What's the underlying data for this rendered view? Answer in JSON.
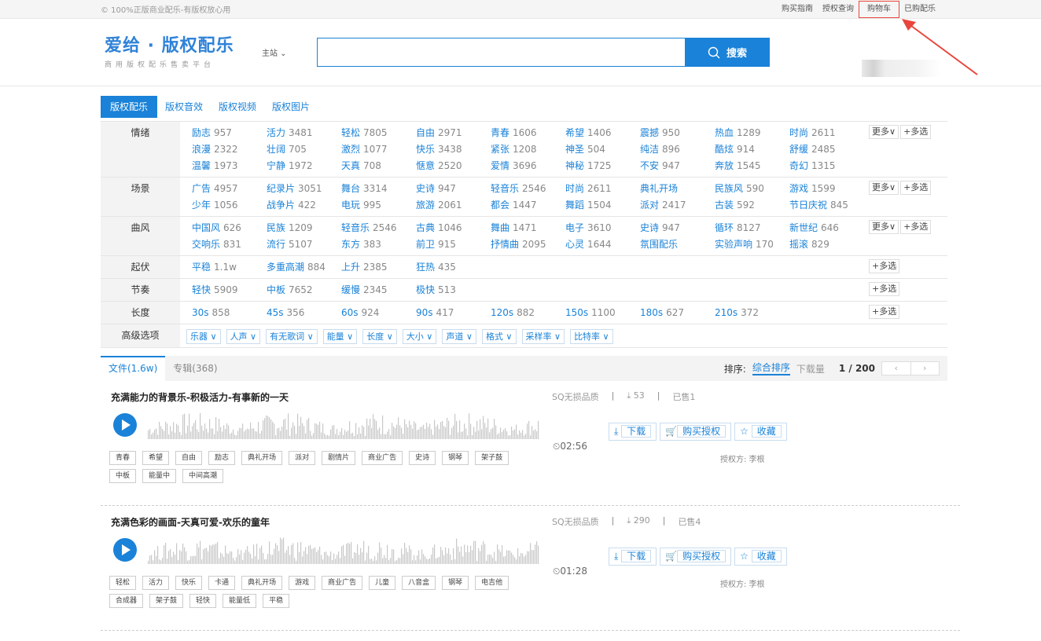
{
  "topbar": {
    "slogan": "© 100%正版商业配乐-有版权放心用",
    "links": [
      "购买指南",
      "授权查询",
      "购物车",
      "已购配乐"
    ]
  },
  "logo": {
    "title": "爱给 · 版权配乐",
    "subtitle": "商用版权配乐售卖平台"
  },
  "site_selector": "主站 ⌄",
  "search": {
    "value": "",
    "button": "搜索"
  },
  "main_tabs": [
    "版权配乐",
    "版权音效",
    "版权视频",
    "版权图片"
  ],
  "filters": {
    "mood": {
      "label": "情绪",
      "items": [
        [
          "励志",
          "957"
        ],
        [
          "活力",
          "3481"
        ],
        [
          "轻松",
          "7805"
        ],
        [
          "自由",
          "2971"
        ],
        [
          "青春",
          "1606"
        ],
        [
          "希望",
          "1406"
        ],
        [
          "震撼",
          "950"
        ],
        [
          "热血",
          "1289"
        ],
        [
          "时尚",
          "2611"
        ],
        [
          "浪漫",
          "2322"
        ],
        [
          "壮阔",
          "705"
        ],
        [
          "激烈",
          "1077"
        ],
        [
          "快乐",
          "3438"
        ],
        [
          "紧张",
          "1208"
        ],
        [
          "神圣",
          "504"
        ],
        [
          "纯洁",
          "896"
        ],
        [
          "酷炫",
          "914"
        ],
        [
          "舒缓",
          "2485"
        ],
        [
          "温馨",
          "1973"
        ],
        [
          "宁静",
          "1972"
        ],
        [
          "天真",
          "708"
        ],
        [
          "惬意",
          "2520"
        ],
        [
          "爱情",
          "3696"
        ],
        [
          "神秘",
          "1725"
        ],
        [
          "不安",
          "947"
        ],
        [
          "奔放",
          "1545"
        ],
        [
          "奇幻",
          "1315"
        ]
      ]
    },
    "scene": {
      "label": "场景",
      "items": [
        [
          "广告",
          "4957"
        ],
        [
          "纪录片",
          "3051"
        ],
        [
          "舞台",
          "3314"
        ],
        [
          "史诗",
          "947"
        ],
        [
          "轻音乐",
          "2546"
        ],
        [
          "时尚",
          "2611"
        ],
        [
          "典礼开场",
          ""
        ],
        [
          "民族风",
          "590"
        ],
        [
          "游戏",
          "1599"
        ],
        [
          "少年",
          "1056"
        ],
        [
          "战争片",
          "422"
        ],
        [
          "电玩",
          "995"
        ],
        [
          "旅游",
          "2061"
        ],
        [
          "都会",
          "1447"
        ],
        [
          "舞蹈",
          "1504"
        ],
        [
          "派对",
          "2417"
        ],
        [
          "古装",
          "592"
        ],
        [
          "节日庆祝",
          "845"
        ]
      ]
    },
    "style": {
      "label": "曲风",
      "items": [
        [
          "中国风",
          "626"
        ],
        [
          "民族",
          "1209"
        ],
        [
          "轻音乐",
          "2546"
        ],
        [
          "古典",
          "1046"
        ],
        [
          "舞曲",
          "1471"
        ],
        [
          "电子",
          "3610"
        ],
        [
          "史诗",
          "947"
        ],
        [
          "循环",
          "8127"
        ],
        [
          "新世纪",
          "646"
        ],
        [
          "交响乐",
          "831"
        ],
        [
          "流行",
          "5107"
        ],
        [
          "东方",
          "383"
        ],
        [
          "前卫",
          "915"
        ],
        [
          "抒情曲",
          "2095"
        ],
        [
          "心灵",
          "1644"
        ],
        [
          "氛围配乐",
          ""
        ],
        [
          "实验声响",
          "170"
        ],
        [
          "摇滚",
          "829"
        ]
      ]
    },
    "rise": {
      "label": "起伏",
      "items": [
        [
          "平稳",
          "1.1w"
        ],
        [
          "多重高潮",
          "884"
        ],
        [
          "上升",
          "2385"
        ],
        [
          "狂热",
          "435"
        ]
      ]
    },
    "tempo": {
      "label": "节奏",
      "items": [
        [
          "轻快",
          "5909"
        ],
        [
          "中板",
          "7652"
        ],
        [
          "缓慢",
          "2345"
        ],
        [
          "极快",
          "513"
        ]
      ]
    },
    "length": {
      "label": "长度",
      "items": [
        [
          "30s",
          "858"
        ],
        [
          "45s",
          "356"
        ],
        [
          "60s",
          "924"
        ],
        [
          "90s",
          "417"
        ],
        [
          "120s",
          "882"
        ],
        [
          "150s",
          "1100"
        ],
        [
          "180s",
          "627"
        ],
        [
          "210s",
          "372"
        ]
      ]
    },
    "advanced": {
      "label": "高级选项",
      "items": [
        "乐器 ∨",
        "人声 ∨",
        "有无歌词 ∨",
        "能量 ∨",
        "长度 ∨",
        "大小 ∨",
        "声道 ∨",
        "格式 ∨",
        "采样率 ∨",
        "比特率 ∨"
      ]
    },
    "more_label": "更多∨",
    "multi_label": "+多选"
  },
  "list": {
    "tabs": [
      "文件(1.6w)",
      "专辑(368)"
    ],
    "sort_label": "排序:",
    "sort_options": [
      "综合排序",
      "下载量"
    ],
    "page": "1 / 200",
    "prev": "‹",
    "next": "›"
  },
  "tracks": [
    {
      "title": "充满能力的背景乐-积极活力-有事新的一天",
      "quality": "SQ无损品质",
      "downloads": "53",
      "sold": "已售1",
      "duration": "02:56",
      "actions": [
        "下载",
        "购买授权",
        "收藏"
      ],
      "owner": "授权方: 李根",
      "tags": [
        "青春",
        "希望",
        "自由",
        "励志",
        "典礼开场",
        "派对",
        "剧情片",
        "商业广告",
        "史诗",
        "钢琴",
        "架子鼓",
        "中板",
        "能量中",
        "中间高潮"
      ]
    },
    {
      "title": "充满色彩的画面-天真可爱-欢乐的童年",
      "quality": "SQ无损品质",
      "downloads": "290",
      "sold": "已售4",
      "duration": "01:28",
      "actions": [
        "下载",
        "购买授权",
        "收藏"
      ],
      "owner": "授权方: 李根",
      "tags": [
        "轻松",
        "活力",
        "快乐",
        "卡通",
        "典礼开场",
        "游戏",
        "商业广告",
        "儿童",
        "八音盒",
        "钢琴",
        "电吉他",
        "合成器",
        "架子鼓",
        "轻快",
        "能量低",
        "平稳"
      ]
    }
  ],
  "colors": {
    "accent": "#1a82d8",
    "highlight": "#e8463c"
  }
}
